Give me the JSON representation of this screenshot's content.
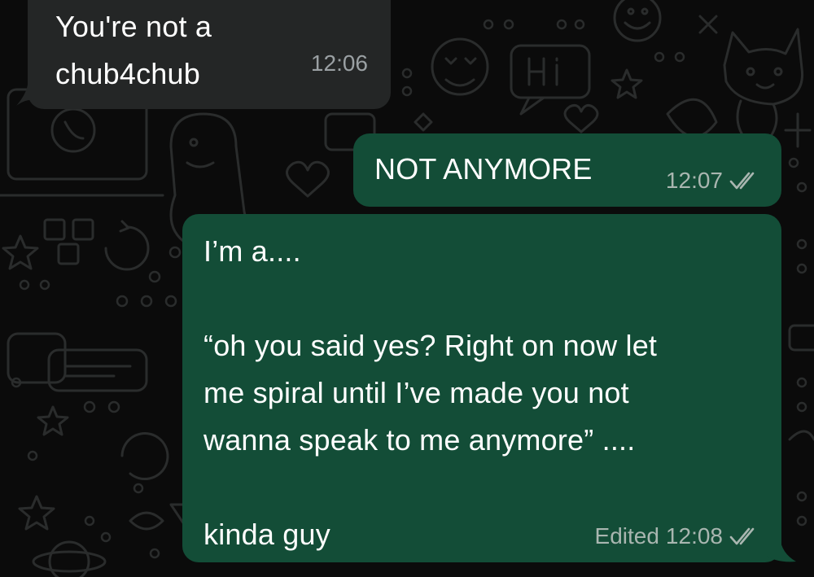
{
  "theme": {
    "background": "#0b0b0b",
    "incoming_bubble": "#242626",
    "outgoing_bubble": "#134d37",
    "doodle_stroke": "#2a2c2c",
    "meta_text": "#a9b6b0",
    "tick_color": "#a9b6b0"
  },
  "messages": [
    {
      "direction": "incoming",
      "text": "You're not a\nchub4chub",
      "time": "12:06",
      "edited_label": "",
      "status_icon": "none"
    },
    {
      "direction": "outgoing",
      "text": "NOT ANYMORE",
      "time": "12:07",
      "edited_label": "",
      "status_icon": "double-check-icon"
    },
    {
      "direction": "outgoing",
      "text": "I’m a....\n\n“oh you said yes? Right on now let\nme spiral until I’ve made you not\nwanna speak to me anymore” ....\n\nkinda guy",
      "time": "12:08",
      "edited_label": "Edited",
      "status_icon": "double-check-icon"
    }
  ],
  "wallpaper_doodles": [
    "hi-speech-bubble-icon",
    "heart-eyes-emoji-icon",
    "cat-icon",
    "phone-bubble-icon",
    "laptop-icon",
    "dinosaur-icon",
    "game-controller-icon",
    "star-icon",
    "heart-icon",
    "planet-icon",
    "chat-bubble-icon",
    "refresh-icon"
  ]
}
